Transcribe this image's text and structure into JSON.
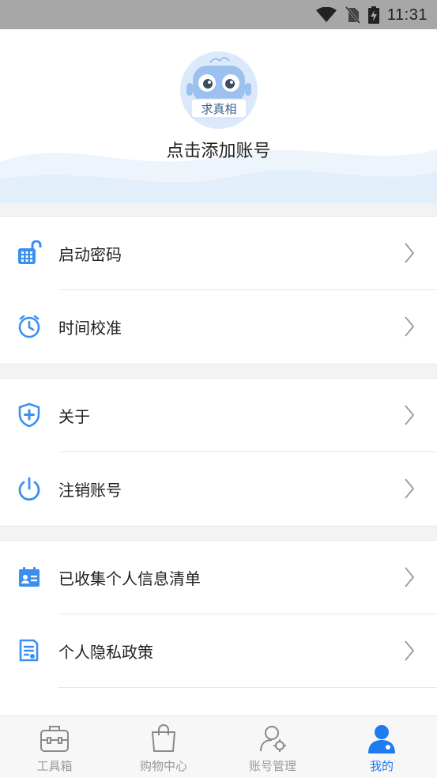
{
  "status_bar": {
    "time": "11:31",
    "icons": [
      "wifi-icon",
      "no-sim-icon",
      "battery-charging-icon"
    ]
  },
  "header": {
    "add_account": "点击添加账号",
    "avatar_text": "求真相"
  },
  "groups": [
    {
      "items": [
        {
          "label": "启动密码",
          "icon": "keypad-lock-icon"
        },
        {
          "label": "时间校准",
          "icon": "clock-icon"
        }
      ]
    },
    {
      "items": [
        {
          "label": "关于",
          "icon": "shield-plus-icon"
        },
        {
          "label": "注销账号",
          "icon": "power-icon"
        }
      ]
    },
    {
      "items": [
        {
          "label": "已收集个人信息清单",
          "icon": "id-card-icon"
        },
        {
          "label": "个人隐私政策",
          "icon": "document-icon"
        }
      ]
    }
  ],
  "tabbar": {
    "tabs": [
      {
        "label": "工具箱",
        "icon": "toolbox-icon"
      },
      {
        "label": "购物中心",
        "icon": "shopping-bag-icon"
      },
      {
        "label": "账号管理",
        "icon": "user-settings-icon"
      },
      {
        "label": "我的",
        "icon": "profile-icon"
      }
    ],
    "active_color": "#1e7bf0",
    "inactive_color": "#9a9a9a"
  },
  "colors": {
    "accent": "#1e7bf0",
    "icon_blue": "#3b8ff0"
  }
}
